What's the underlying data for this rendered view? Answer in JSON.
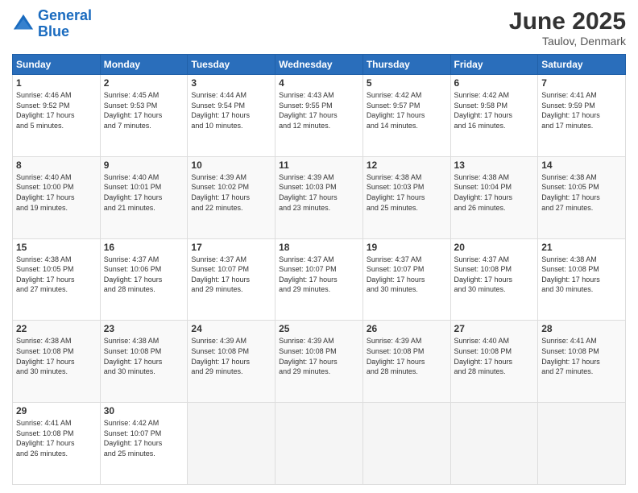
{
  "logo": {
    "line1": "General",
    "line2": "Blue"
  },
  "title": {
    "month_year": "June 2025",
    "location": "Taulov, Denmark"
  },
  "headers": [
    "Sunday",
    "Monday",
    "Tuesday",
    "Wednesday",
    "Thursday",
    "Friday",
    "Saturday"
  ],
  "weeks": [
    [
      {
        "day": "1",
        "sunrise": "4:46 AM",
        "sunset": "9:52 PM",
        "daylight": "17 hours and 5 minutes."
      },
      {
        "day": "2",
        "sunrise": "4:45 AM",
        "sunset": "9:53 PM",
        "daylight": "17 hours and 7 minutes."
      },
      {
        "day": "3",
        "sunrise": "4:44 AM",
        "sunset": "9:54 PM",
        "daylight": "17 hours and 10 minutes."
      },
      {
        "day": "4",
        "sunrise": "4:43 AM",
        "sunset": "9:55 PM",
        "daylight": "17 hours and 12 minutes."
      },
      {
        "day": "5",
        "sunrise": "4:42 AM",
        "sunset": "9:57 PM",
        "daylight": "17 hours and 14 minutes."
      },
      {
        "day": "6",
        "sunrise": "4:42 AM",
        "sunset": "9:58 PM",
        "daylight": "17 hours and 16 minutes."
      },
      {
        "day": "7",
        "sunrise": "4:41 AM",
        "sunset": "9:59 PM",
        "daylight": "17 hours and 17 minutes."
      }
    ],
    [
      {
        "day": "8",
        "sunrise": "4:40 AM",
        "sunset": "10:00 PM",
        "daylight": "17 hours and 19 minutes."
      },
      {
        "day": "9",
        "sunrise": "4:40 AM",
        "sunset": "10:01 PM",
        "daylight": "17 hours and 21 minutes."
      },
      {
        "day": "10",
        "sunrise": "4:39 AM",
        "sunset": "10:02 PM",
        "daylight": "17 hours and 22 minutes."
      },
      {
        "day": "11",
        "sunrise": "4:39 AM",
        "sunset": "10:03 PM",
        "daylight": "17 hours and 23 minutes."
      },
      {
        "day": "12",
        "sunrise": "4:38 AM",
        "sunset": "10:03 PM",
        "daylight": "17 hours and 25 minutes."
      },
      {
        "day": "13",
        "sunrise": "4:38 AM",
        "sunset": "10:04 PM",
        "daylight": "17 hours and 26 minutes."
      },
      {
        "day": "14",
        "sunrise": "4:38 AM",
        "sunset": "10:05 PM",
        "daylight": "17 hours and 27 minutes."
      }
    ],
    [
      {
        "day": "15",
        "sunrise": "4:38 AM",
        "sunset": "10:05 PM",
        "daylight": "17 hours and 27 minutes."
      },
      {
        "day": "16",
        "sunrise": "4:37 AM",
        "sunset": "10:06 PM",
        "daylight": "17 hours and 28 minutes."
      },
      {
        "day": "17",
        "sunrise": "4:37 AM",
        "sunset": "10:07 PM",
        "daylight": "17 hours and 29 minutes."
      },
      {
        "day": "18",
        "sunrise": "4:37 AM",
        "sunset": "10:07 PM",
        "daylight": "17 hours and 29 minutes."
      },
      {
        "day": "19",
        "sunrise": "4:37 AM",
        "sunset": "10:07 PM",
        "daylight": "17 hours and 30 minutes."
      },
      {
        "day": "20",
        "sunrise": "4:37 AM",
        "sunset": "10:08 PM",
        "daylight": "17 hours and 30 minutes."
      },
      {
        "day": "21",
        "sunrise": "4:38 AM",
        "sunset": "10:08 PM",
        "daylight": "17 hours and 30 minutes."
      }
    ],
    [
      {
        "day": "22",
        "sunrise": "4:38 AM",
        "sunset": "10:08 PM",
        "daylight": "17 hours and 30 minutes."
      },
      {
        "day": "23",
        "sunrise": "4:38 AM",
        "sunset": "10:08 PM",
        "daylight": "17 hours and 30 minutes."
      },
      {
        "day": "24",
        "sunrise": "4:39 AM",
        "sunset": "10:08 PM",
        "daylight": "17 hours and 29 minutes."
      },
      {
        "day": "25",
        "sunrise": "4:39 AM",
        "sunset": "10:08 PM",
        "daylight": "17 hours and 29 minutes."
      },
      {
        "day": "26",
        "sunrise": "4:39 AM",
        "sunset": "10:08 PM",
        "daylight": "17 hours and 28 minutes."
      },
      {
        "day": "27",
        "sunrise": "4:40 AM",
        "sunset": "10:08 PM",
        "daylight": "17 hours and 28 minutes."
      },
      {
        "day": "28",
        "sunrise": "4:41 AM",
        "sunset": "10:08 PM",
        "daylight": "17 hours and 27 minutes."
      }
    ],
    [
      {
        "day": "29",
        "sunrise": "4:41 AM",
        "sunset": "10:08 PM",
        "daylight": "17 hours and 26 minutes."
      },
      {
        "day": "30",
        "sunrise": "4:42 AM",
        "sunset": "10:07 PM",
        "daylight": "17 hours and 25 minutes."
      },
      null,
      null,
      null,
      null,
      null
    ]
  ],
  "labels": {
    "sunrise": "Sunrise:",
    "sunset": "Sunset:",
    "daylight": "Daylight:"
  }
}
